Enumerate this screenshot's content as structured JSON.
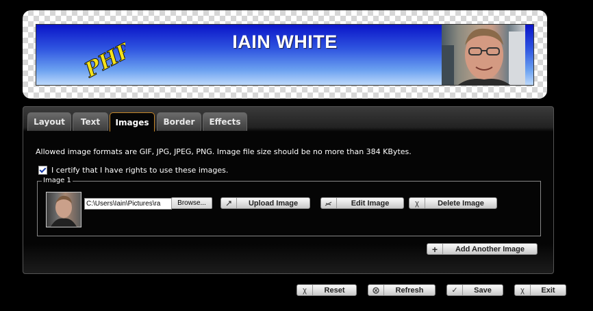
{
  "banner": {
    "title": "IAIN WHITE",
    "logo_text": "PHP"
  },
  "tabs": [
    {
      "label": "Layout"
    },
    {
      "label": "Text"
    },
    {
      "label": "Images",
      "active": true
    },
    {
      "label": "Border"
    },
    {
      "label": "Effects"
    }
  ],
  "images_tab": {
    "allowed_formats_text": "Allowed image formats are GIF, JPG, JPEG, PNG. Image file size should be no more than 384 KBytes.",
    "certify_label": "I certify that I have rights to use these images.",
    "certify_checked": true,
    "image1": {
      "legend": "Image 1",
      "path_value": "C:\\Users\\Iain\\Pictures\\ra",
      "browse_label": "Browse...",
      "upload_label": "Upload Image",
      "edit_label": "Edit Image",
      "delete_label": "Delete Image"
    },
    "add_another_label": "Add Another Image"
  },
  "footer": {
    "reset_label": "Reset",
    "refresh_label": "Refresh",
    "save_label": "Save",
    "exit_label": "Exit"
  },
  "colors": {
    "active_tab_border": "#c8882a",
    "banner_gradient_top": "#0a14c8",
    "banner_gradient_bottom": "#bcd8fb",
    "logo_yellow": "#f4e21a"
  },
  "icons": {
    "upload": "upload-icon",
    "edit": "edit-icon",
    "delete": "delete-icon",
    "add": "plus-icon",
    "reset": "reset-icon",
    "refresh": "refresh-icon",
    "save": "check-icon",
    "exit": "exit-icon"
  }
}
